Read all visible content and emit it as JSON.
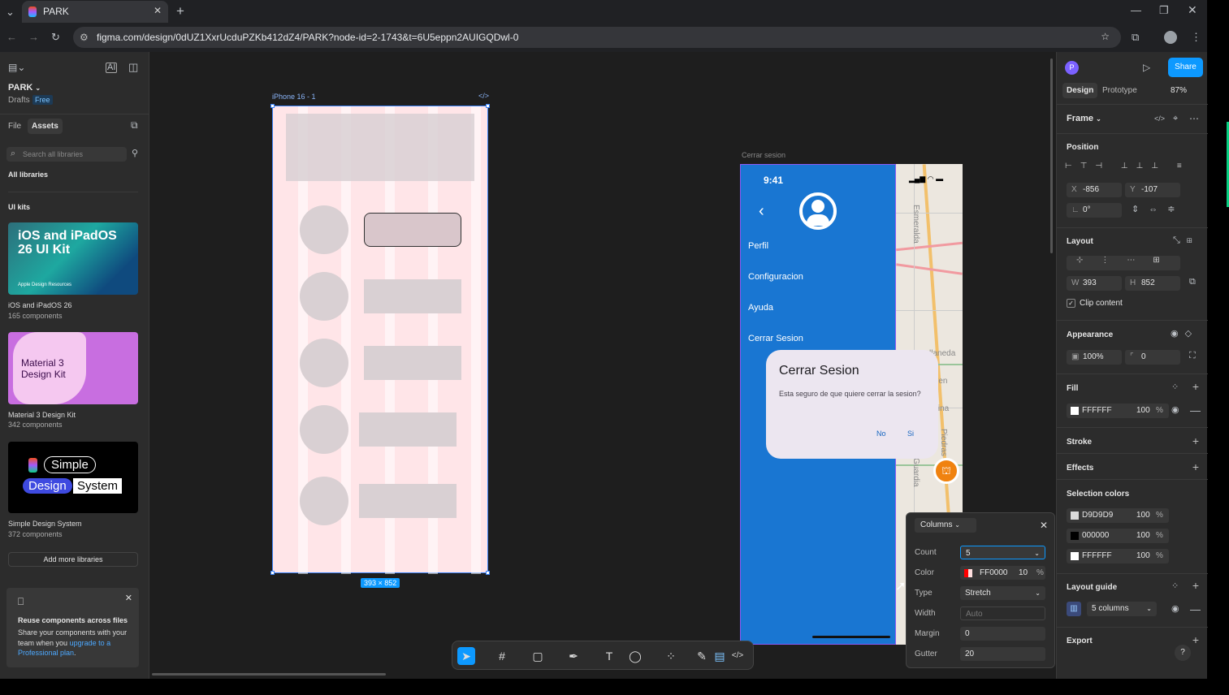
{
  "browser": {
    "tab_title": "PARK",
    "url": "figma.com/design/0dUZ1XxrUcduPZKb412dZ4/PARK?node-id=2-1743&t=6U5eppn2AUIGQDwl-0"
  },
  "left_panel": {
    "file_name": "PARK",
    "drafts": "Drafts",
    "plan": "Free",
    "tab_file": "File",
    "tab_assets": "Assets",
    "search_placeholder": "Search all libraries",
    "all_libraries": "All libraries",
    "ui_kits": "UI kits",
    "kits": [
      {
        "thumb_title": "iOS and iPadOS 26 UI Kit",
        "thumb_sub": "Apple Design Resources",
        "name": "iOS and iPadOS 26",
        "count": "165 components"
      },
      {
        "thumb_title": "Material 3 Design Kit",
        "name": "Material 3 Design Kit",
        "count": "342 components"
      },
      {
        "thumb_words": [
          "Simple",
          "Design",
          "System"
        ],
        "name": "Simple Design System",
        "count": "372 components"
      }
    ],
    "add_more": "Add more libraries",
    "promo": {
      "title": "Reuse components across files",
      "body": "Share your components with your team when you",
      "link": "upgrade to a Professional plan",
      "end": "."
    }
  },
  "canvas": {
    "frame1_label": "iPhone 16 - 1",
    "frame1_size": "393 × 852",
    "frame2_label": "Cerrar sesion",
    "phone": {
      "time": "9:41",
      "menu": [
        "Perfil",
        "Configuracion",
        "Ayuda",
        "Cerrar Sesion"
      ],
      "dialog_title": "Cerrar Sesion",
      "dialog_body": "Esta seguro de que quiere cerrar la sesion?",
      "no": "No",
      "si": "Si",
      "map_labels": [
        "Esmeralda",
        "Avellaneda",
        "Yrigoyen",
        "Alsina",
        "Piedras",
        "Guardia"
      ]
    }
  },
  "columns_popup": {
    "title": "Columns",
    "count_label": "Count",
    "count": "5",
    "color_label": "Color",
    "color_hex": "FF0000",
    "color_opacity": "10",
    "pct": "%",
    "type_label": "Type",
    "type": "Stretch",
    "width_label": "Width",
    "width_placeholder": "Auto",
    "margin_label": "Margin",
    "margin": "0",
    "gutter_label": "Gutter",
    "gutter": "20"
  },
  "right_panel": {
    "avatar": "P",
    "share": "Share",
    "tab_design": "Design",
    "tab_prototype": "Prototype",
    "zoom": "87%",
    "frame": "Frame",
    "position": "Position",
    "x_label": "X",
    "x": "-856",
    "y_label": "Y",
    "y": "-107",
    "rotation": "0°",
    "layout": "Layout",
    "w_label": "W",
    "w": "393",
    "h_label": "H",
    "h": "852",
    "clip": "Clip content",
    "appearance": "Appearance",
    "opacity": "100%",
    "radius": "0",
    "fill": "Fill",
    "fill_hex": "FFFFFF",
    "fill_op": "100",
    "pct": "%",
    "stroke": "Stroke",
    "effects": "Effects",
    "selection_colors": "Selection colors",
    "sel_colors": [
      {
        "hex": "D9D9D9",
        "op": "100",
        "swatch": "#d9d9d9"
      },
      {
        "hex": "000000",
        "op": "100",
        "swatch": "#000000"
      },
      {
        "hex": "FFFFFF",
        "op": "100",
        "swatch": "#ffffff"
      }
    ],
    "layout_guide": "Layout guide",
    "guide_value": "5 columns",
    "export": "Export",
    "help": "?"
  },
  "colors": {
    "accent": "#0d99ff",
    "phone_blue": "#1976d2",
    "frame_pink": "#ffe5e8",
    "guide_red": "#ff0000"
  }
}
